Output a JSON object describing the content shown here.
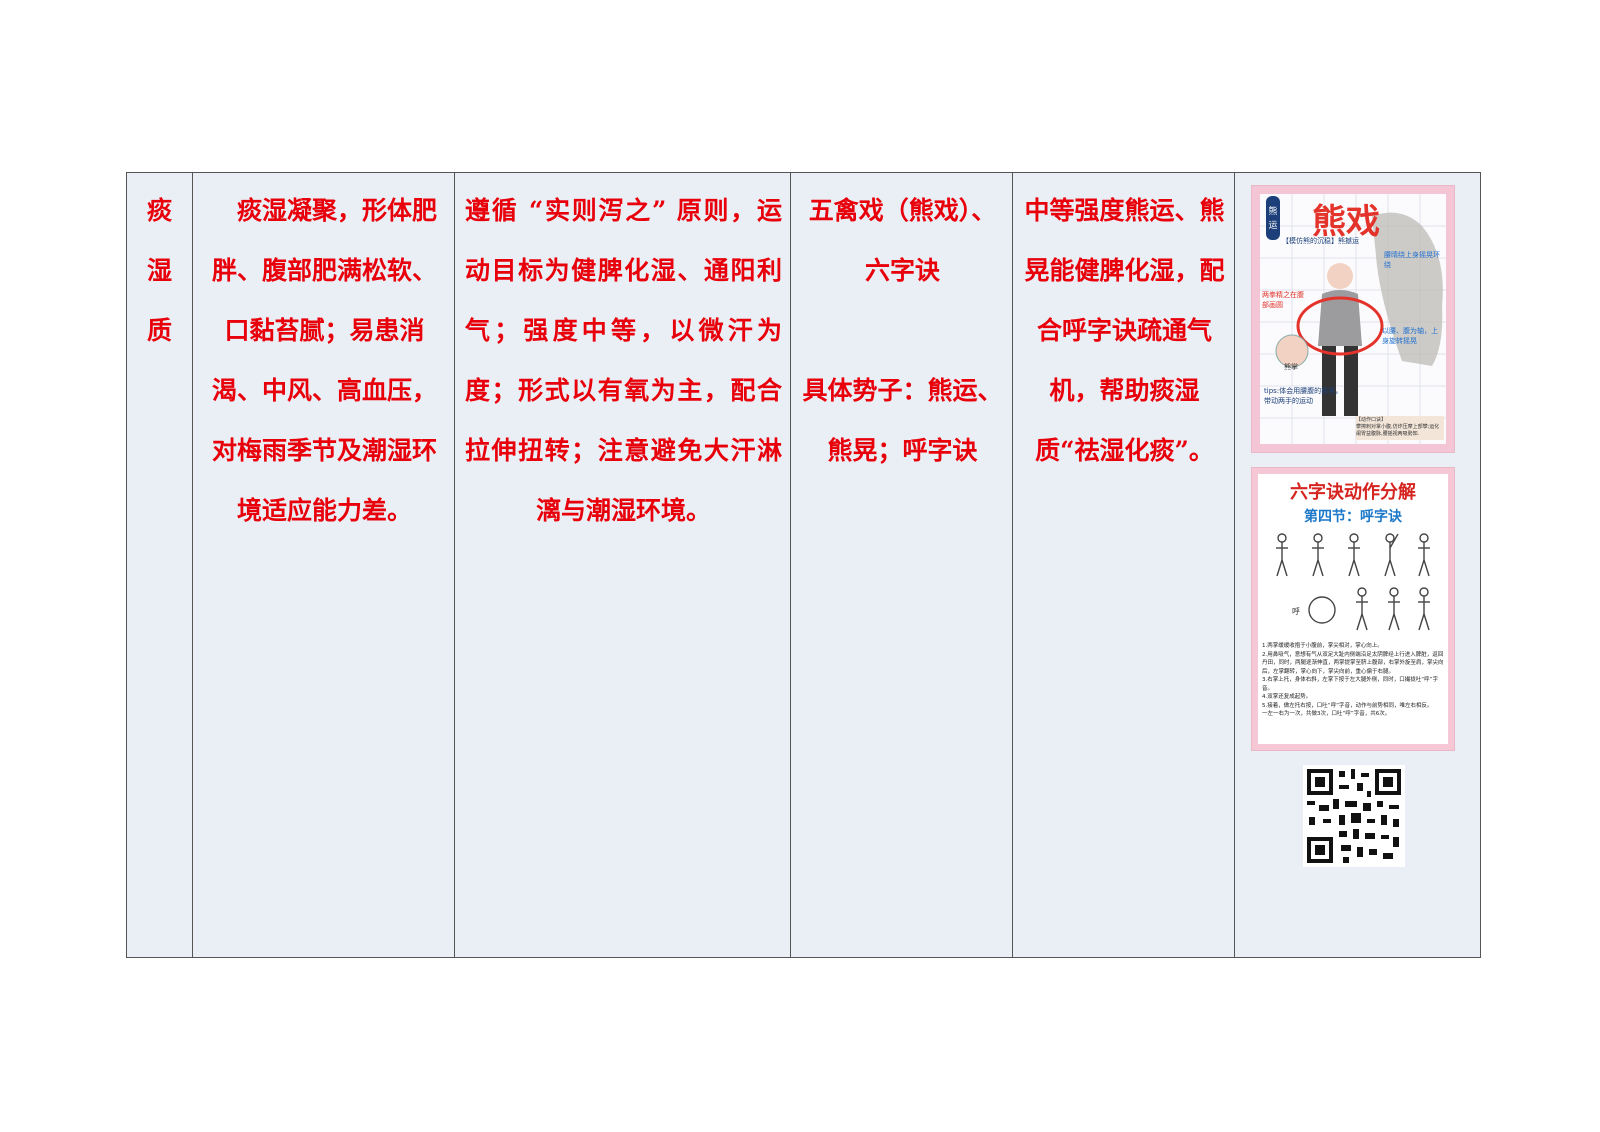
{
  "table": {
    "col1_chars": [
      "痰",
      "湿",
      "质"
    ],
    "col2": "痰湿凝聚，形体肥胖、腹部肥满松软、口黏苔腻；易患消渴、中风、高血压，对梅雨季节及潮湿环境适应能力差。",
    "col3": "遵循 “实则泻之” 原则，运动目标为健脾化湿、通阳利气；强度中等，以微汗为度；形式以有氧为主，配合拉伸扭转；注意避免大汗淋漓与潮湿环境。",
    "col4_line1": "五禽戏（熊戏）、六字诀",
    "col4_line2": "具体势子：熊运、熊晃；呼字诀",
    "col5": "中等强度熊运、熊晃能健脾化湿，配合呼字诀疏通气机，帮助痰湿质“祛湿化痰”。"
  },
  "images": {
    "bear": {
      "badge": "熊运",
      "title": "熊戏",
      "subtitle": "【模仿熊的沉稳】熊撼运",
      "note1": "腰晴绕上身摇晃环绕",
      "note2": "两拳精之在腹部画圆",
      "note3": "以腰、腹为轴，上身旋转摇晃",
      "hand_label": "熊掌",
      "tips": "tips:体会用腰腹的摇晃，带动两手的运动",
      "footer": "【动作口诀】",
      "footer2": "攀擦刺对掌小腹,仿炸压摩上部攀;运化阑胃益腹脉,腰摇视两吸勢知."
    },
    "six": {
      "title": "六字诀动作分解",
      "subtitle": "第四节：呼字诀",
      "face_label": "呼",
      "steps": [
        "1.两掌缓缓收抱于小腹前，掌尖相对，掌心向上。",
        "2.用鼻吸气，意想有气从双足大趾内侧端沿足太阴脾经上行进入脾脏，返回丹田，同时，两腿逐渐伸直，两掌提掌至脐上腹部，右掌外旋至肩，掌尖向后，左掌翻转，掌心向下，掌尖向前，重心偏于右腿。",
        "3.右掌上托，身体右斜，左掌下按于左大腿外侧，同时，口撮拢吐“呼”字音。",
        "4.双掌还复成起势。",
        "5.接着，做左托右按，口吐“呼”字音，动作与前势相同，唯左右相反。",
        "一左一右为一次，共做3次，口吐“呼”字音，共6次。"
      ]
    }
  },
  "colors": {
    "text_red": "#e8000b",
    "cell_bg": "#eaeff6",
    "border": "#555555"
  }
}
